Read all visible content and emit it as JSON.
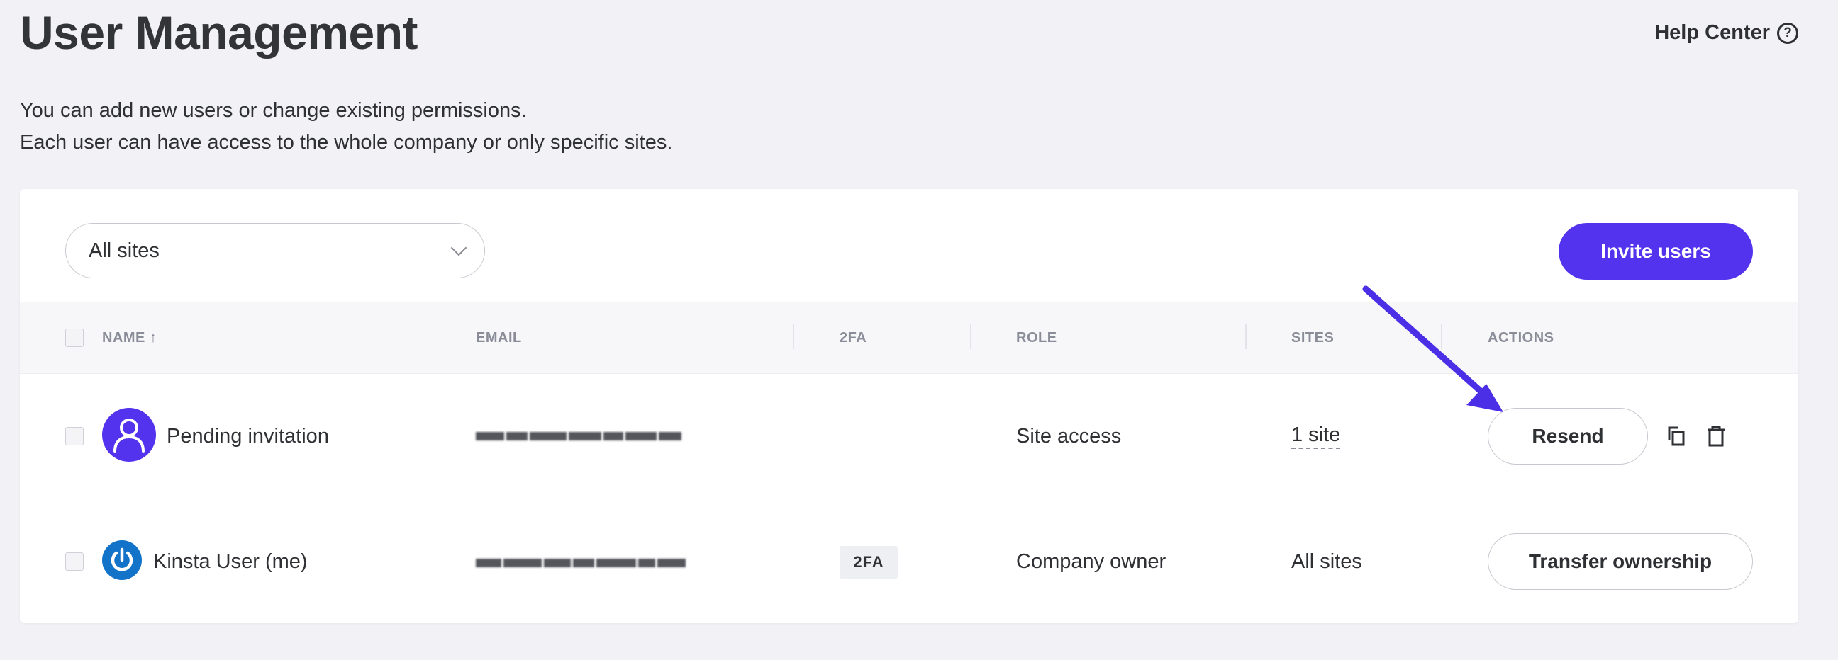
{
  "header": {
    "title": "User Management",
    "help_center": "Help Center",
    "help_icon": "question-circle-icon"
  },
  "intro": {
    "line1": "You can add new users or change existing permissions.",
    "line2": "Each user can have access to the whole company or only specific sites."
  },
  "toolbar": {
    "site_filter_value": "All sites",
    "invite_button": "Invite users"
  },
  "table": {
    "columns": [
      "NAME ↑",
      "EMAIL",
      "2FA",
      "ROLE",
      "SITES",
      "ACTIONS"
    ],
    "rows": [
      {
        "name": "Pending invitation",
        "avatar": "user-icon",
        "email": "",
        "twofa": "",
        "role": "Site access",
        "sites": "1 site",
        "primary_action": "Resend",
        "extra_actions": [
          "copy-icon",
          "trash-icon"
        ]
      },
      {
        "name": "Kinsta User (me)",
        "avatar": "kinsta-power-icon",
        "email": "",
        "twofa": "2FA",
        "role": "Company owner",
        "sites": "All sites",
        "primary_action": "Transfer ownership"
      }
    ]
  },
  "colors": {
    "accent": "#5333ed",
    "background": "#f1f1f6",
    "kinsta_blue": "#1373c9",
    "text": "#2e3033",
    "muted": "#8a8c98"
  }
}
